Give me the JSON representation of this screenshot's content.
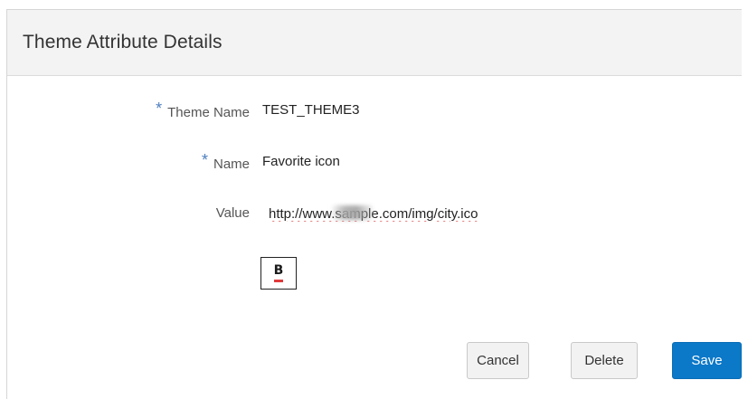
{
  "dialog": {
    "title": "Theme Attribute Details"
  },
  "form": {
    "theme_name": {
      "required_marker": "*",
      "label": "Theme Name",
      "value": "TEST_THEME3"
    },
    "name": {
      "required_marker": "*",
      "label": "Name",
      "value": "Favorite icon"
    },
    "value": {
      "label": "Value",
      "input_value": "http://www.sample.com/img/city.ico"
    },
    "preview": {
      "icon": "favicon-preview-b-icon",
      "glyph": "B"
    }
  },
  "buttons": {
    "cancel": "Cancel",
    "delete": "Delete",
    "save": "Save"
  },
  "colors": {
    "primary": "#0b78c8",
    "required_asterisk": "#4f7fbf",
    "header_bg": "#f3f3f3"
  }
}
